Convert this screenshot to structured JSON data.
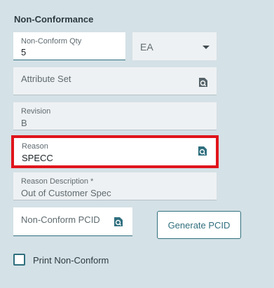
{
  "section": {
    "title": "Non-Conformance"
  },
  "fields": {
    "qty": {
      "label": "Non-Conform Qty",
      "value": "5"
    },
    "uom": {
      "selected": "EA"
    },
    "attribute_set": {
      "placeholder": "Attribute Set"
    },
    "revision": {
      "label": "Revision",
      "value": "B"
    },
    "reason": {
      "label": "Reason",
      "value": "SPECC"
    },
    "reason_description": {
      "label": "Reason Description *",
      "value": "Out of Customer Spec"
    },
    "pcid": {
      "placeholder": "Non-Conform PCID"
    }
  },
  "buttons": {
    "generate_pcid": "Generate PCID"
  },
  "print": {
    "label": "Print Non-Conform",
    "checked": false
  },
  "icons": {
    "lookup": "search-doc-icon",
    "dropdown": "chevron-down-icon"
  },
  "colors": {
    "accent": "#2f6f7e",
    "highlight": "#e0151b",
    "background": "#d4e1e6"
  }
}
